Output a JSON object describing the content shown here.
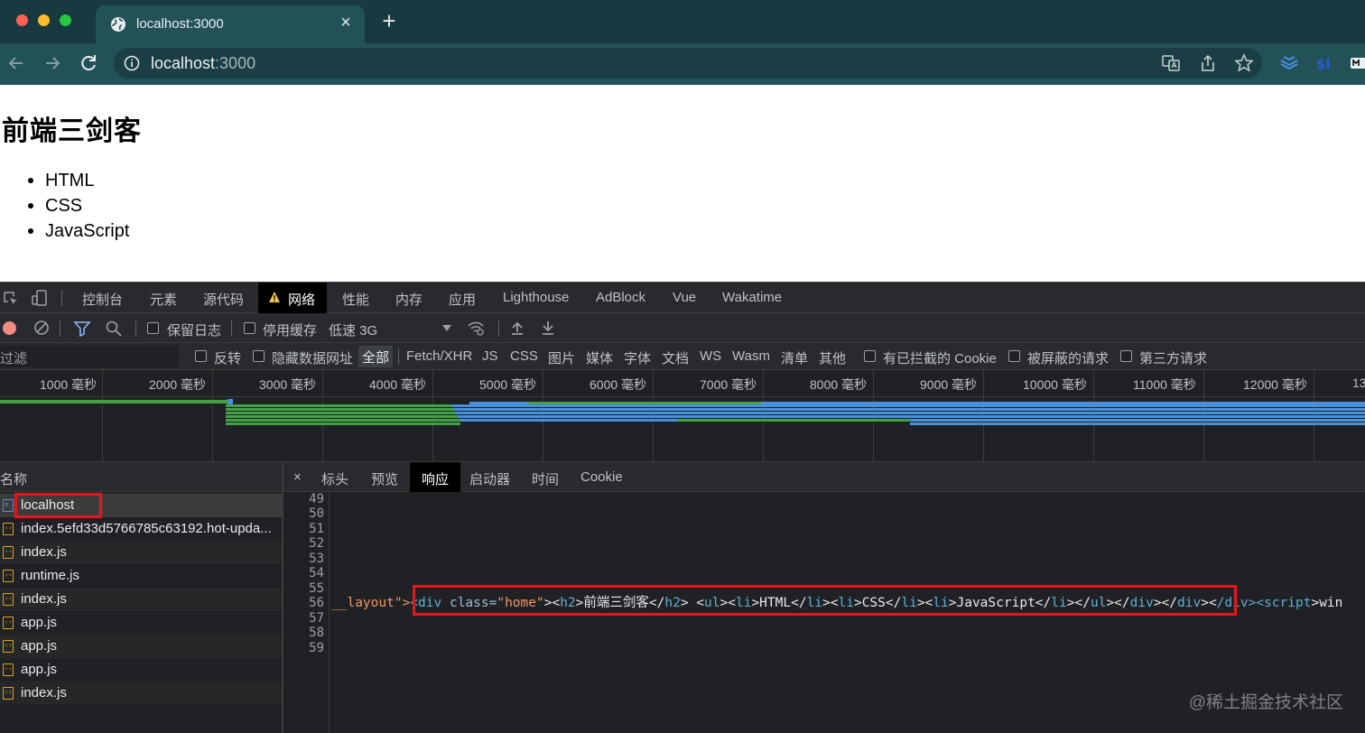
{
  "browser": {
    "tab_title": "localhost:3000",
    "url_host": "localhost",
    "url_port": ":3000",
    "new_tab": "+",
    "close": "×"
  },
  "page": {
    "heading": "前端三剑客",
    "items": [
      "HTML",
      "CSS",
      "JavaScript"
    ]
  },
  "devtools": {
    "tabs": [
      "控制台",
      "元素",
      "源代码",
      "网络",
      "性能",
      "内存",
      "应用",
      "Lighthouse",
      "AdBlock",
      "Vue",
      "Wakatime"
    ],
    "active_tab": "网络",
    "toolbar": {
      "preserve_log": "保留日志",
      "disable_cache": "停用缓存",
      "throttling": "低速 3G"
    },
    "filter": {
      "placeholder": "过滤",
      "invert": "反转",
      "hide_data_urls": "隐藏数据网址",
      "types": [
        "全部",
        "Fetch/XHR",
        "JS",
        "CSS",
        "图片",
        "媒体",
        "字体",
        "文档",
        "WS",
        "Wasm",
        "清单",
        "其他"
      ],
      "blocked_cookies": "有已拦截的 Cookie",
      "blocked_requests": "被屏蔽的请求",
      "third_party": "第三方请求"
    },
    "timeline_ticks": [
      "1000 毫秒",
      "2000 毫秒",
      "3000 毫秒",
      "4000 毫秒",
      "5000 毫秒",
      "6000 毫秒",
      "7000 毫秒",
      "8000 毫秒",
      "9000 毫秒",
      "10000 毫秒",
      "11000 毫秒",
      "12000 毫秒",
      "13"
    ],
    "name_header": "名称",
    "requests": [
      "localhost",
      "index.5efd33d5766785c63192.hot-upda...",
      "index.js",
      "runtime.js",
      "index.js",
      "app.js",
      "app.js",
      "app.js",
      "index.js"
    ],
    "detail_tabs": [
      "标头",
      "预览",
      "响应",
      "启动器",
      "时间",
      "Cookie"
    ],
    "active_detail_tab": "响应",
    "close_detail": "×",
    "line_numbers": [
      "49",
      "50",
      "51",
      "52",
      "53",
      "54",
      "55",
      "56",
      "57",
      "58",
      "59"
    ],
    "code_line_56": {
      "pre": "__layout\">",
      "open_div": "<div",
      "attr": " class=",
      "val": "\"home\"",
      "rest1": "><",
      "h2": "h2",
      "text1": ">前端三剑客</",
      "h2c": "h2",
      "rest2": "> <",
      "ul": "ul",
      "r3": "><",
      "li1": "li",
      "t1": ">HTML</",
      "li1c": "li",
      "r4": "><",
      "li2": "li",
      "t2": ">CSS</",
      "li2c": "li",
      "r5": "><",
      "li3": "li",
      "t3": ">JavaScript</",
      "li3c": "li",
      "r6": "></",
      "ulc": "ul",
      "r7": "></",
      "divc1": "div",
      "r8": "></",
      "divc2": "div",
      "r9": "><",
      "r10": "/div><",
      "script": "script",
      "r11": ">win"
    }
  },
  "watermark": "@稀土掘金技术社区",
  "colors": {
    "chrome_dark": "#17393f",
    "chrome_tab": "#225158",
    "devtools_bg": "#202124",
    "highlight_box": "#e4161d"
  }
}
